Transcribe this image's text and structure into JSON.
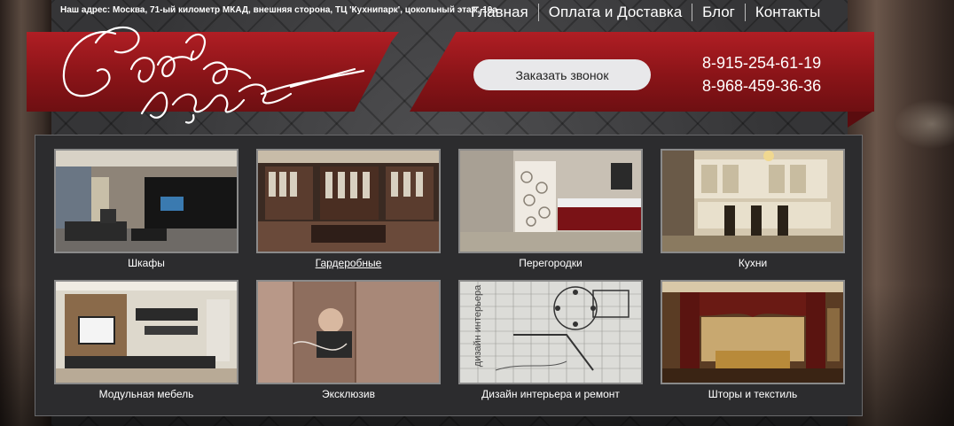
{
  "header": {
    "address": "Наш адрес: Москва, 71-ый километр МКАД, внешняя сторона, ТЦ 'Кухнипарк', цокольный этаж, 10а",
    "logo_text": "Свободный стиль",
    "nav": [
      {
        "label": "Главная"
      },
      {
        "label": "Оплата и Доставка"
      },
      {
        "label": "Блог"
      },
      {
        "label": "Контакты"
      }
    ],
    "call_button": "Заказать звонок",
    "phones": [
      "8-915-254-61-19",
      "8-968-459-36-36"
    ]
  },
  "catalog": {
    "items": [
      {
        "label": "Шкафы",
        "image": "living-room-photo"
      },
      {
        "label": "Гардеробные",
        "image": "walk-in-closet-photo"
      },
      {
        "label": "Перегородки",
        "image": "bedroom-partition-photo"
      },
      {
        "label": "Кухни",
        "image": "classic-kitchen-photo"
      },
      {
        "label": "Модульная мебель",
        "image": "tv-wall-unit-photo"
      },
      {
        "label": "Эксклюзив",
        "image": "printed-wardrobe-photo"
      },
      {
        "label": "Дизайн интерьера и ремонт",
        "image": "floor-plan-drawing",
        "image_text": "дизайн интерьера"
      },
      {
        "label": "Шторы и текстиль",
        "image": "curtains-room-photo"
      }
    ]
  },
  "colors": {
    "brand_red": "#a0181d",
    "panel_dark": "#2c2c2e",
    "button_bg": "#e8e8ea"
  }
}
